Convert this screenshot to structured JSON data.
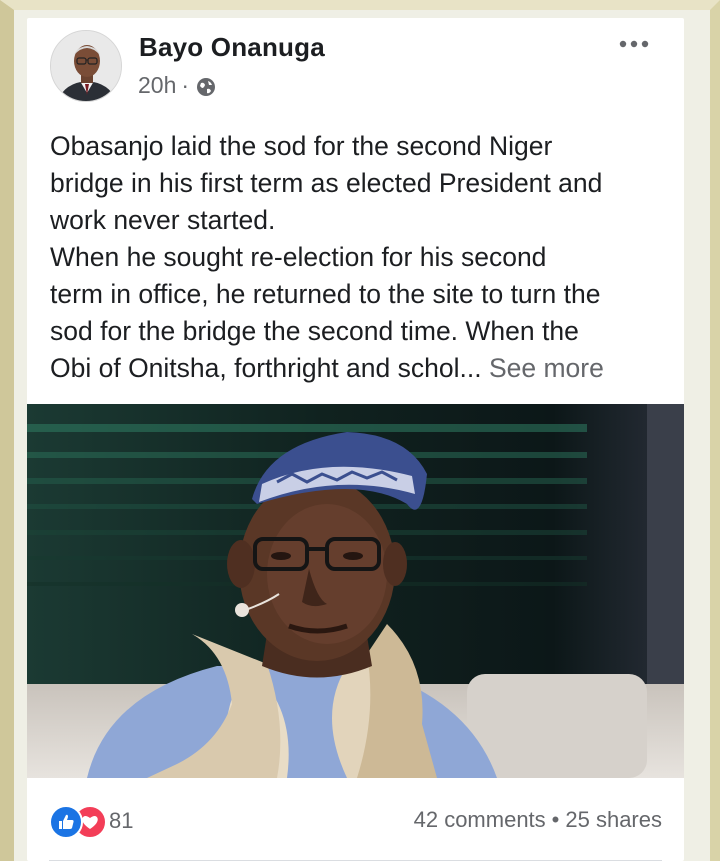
{
  "post": {
    "author": "Bayo Onanuga",
    "time": "20h",
    "separator": "·",
    "privacy_icon": "globe-icon",
    "menu_icon": "more-horizontal-icon",
    "text_lines": [
      "Obasanjo laid the sod for the second Niger",
      "bridge in his first term as elected President and",
      "work never started.",
      "When he sought re-election for his second",
      "term in office, he returned to the site to turn the",
      "sod for the bridge the second time. When the",
      "Obi of Onitsha, forthright and schol..."
    ],
    "see_more": "See more"
  },
  "stats": {
    "reaction_icons": [
      "like-icon",
      "love-icon"
    ],
    "reaction_count": "81",
    "comments": "42 comments",
    "dot": "•",
    "shares": "25 shares"
  },
  "colors": {
    "like": "#1b74e4",
    "love": "#f33e58",
    "secondary_text": "#65676b",
    "primary_text": "#1c1e21"
  }
}
